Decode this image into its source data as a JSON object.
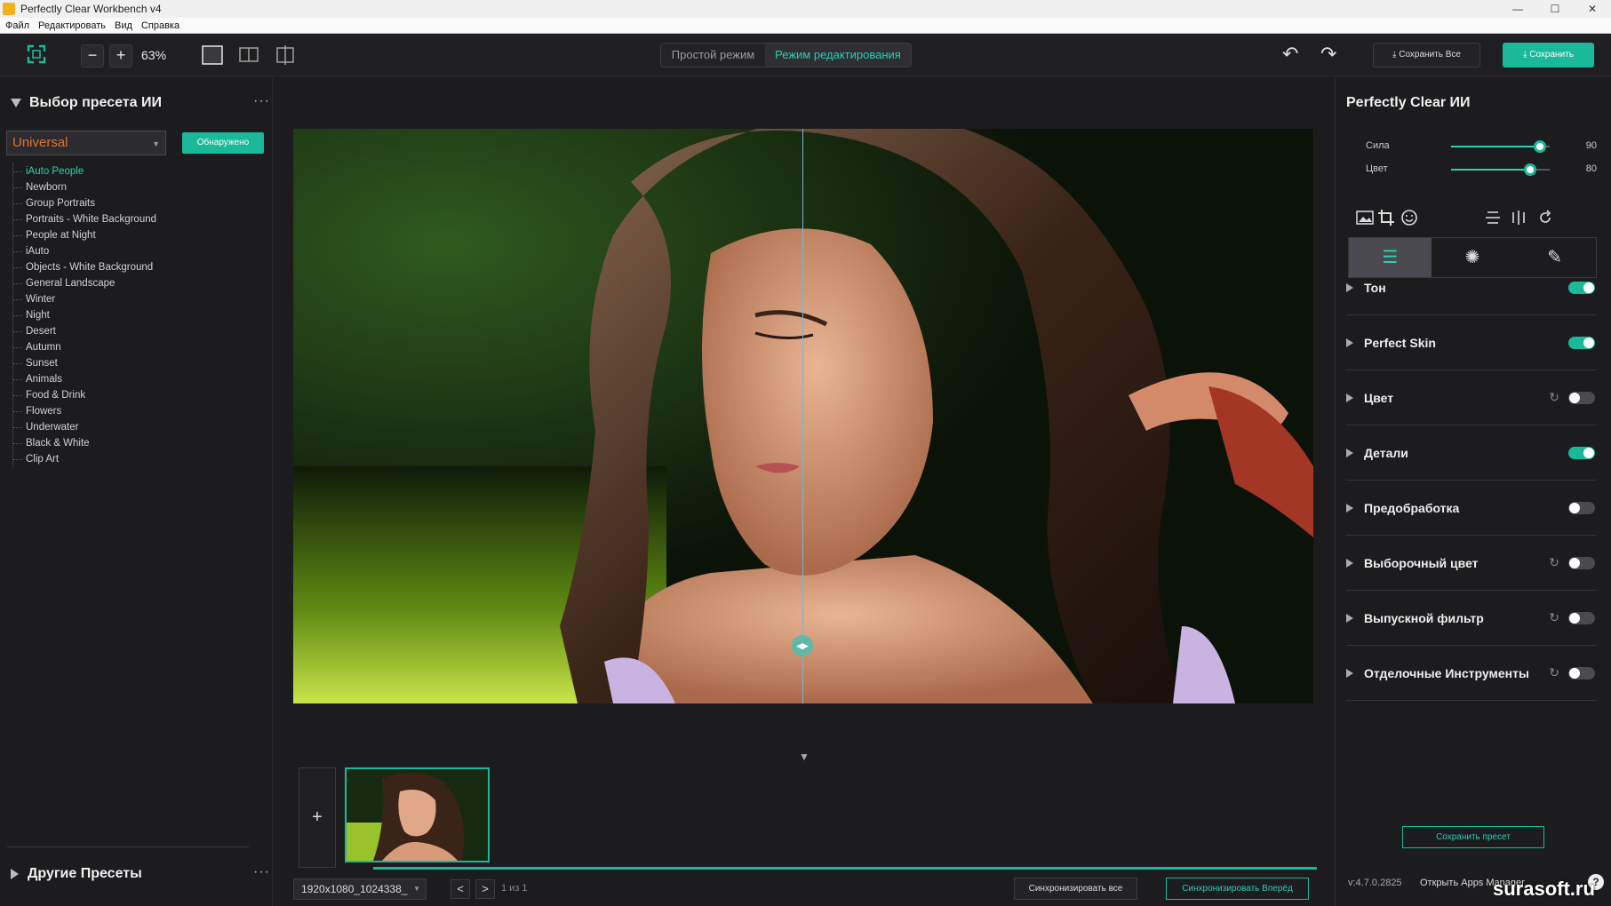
{
  "window": {
    "title": "Perfectly Clear Workbench v4",
    "min": "—",
    "max": "☐",
    "close": "✕"
  },
  "menu": [
    "Файл",
    "Редактировать",
    "Вид",
    "Справка"
  ],
  "toolbar": {
    "zoom_out": "−",
    "zoom_in": "+",
    "zoom": "63%",
    "mode_simple": "Простой режим",
    "mode_edit": "Режим редактирования",
    "undo_icon": "↶",
    "redo_icon": "↷",
    "save_all": "Сохранить Все",
    "save": "Сохранить"
  },
  "left": {
    "title": "Выбор пресета ИИ",
    "preset": "Universal",
    "detected": "Обнаружено",
    "presets": [
      "iAuto People",
      "Newborn",
      "Group Portraits",
      "Portraits - White Background",
      "People at Night",
      "iAuto",
      "Objects - White Background",
      "General Landscape",
      "Winter",
      "Night",
      "Desert",
      "Autumn",
      "Sunset",
      "Animals",
      "Food & Drink",
      "Flowers",
      "Underwater",
      "Black & White",
      "Clip Art"
    ],
    "other_presets": "Другие Пресеты"
  },
  "bottom": {
    "add": "+",
    "file": "1920x1080_1024338_",
    "prev": "<",
    "next": ">",
    "count": "1 из 1",
    "sync_all": "Синхронизировать все",
    "sync_forward": "Синхронизировать Вперёд"
  },
  "right": {
    "title": "Perfectly Clear ИИ",
    "sliders": [
      {
        "label": "Сила",
        "value": "90",
        "level": 0.9
      },
      {
        "label": "Цвет",
        "value": "80",
        "level": 0.8
      }
    ],
    "sections": [
      {
        "name": "Тон",
        "on": true,
        "reset": false
      },
      {
        "name": "Perfect Skin",
        "on": true,
        "reset": false
      },
      {
        "name": "Цвет",
        "on": false,
        "reset": true
      },
      {
        "name": "Детали",
        "on": true,
        "reset": false
      },
      {
        "name": "Предобработка",
        "on": false,
        "reset": false
      },
      {
        "name": "Выборочный цвет",
        "on": false,
        "reset": true
      },
      {
        "name": "Выпускной фильтр",
        "on": false,
        "reset": true
      },
      {
        "name": "Отделочные Инструменты",
        "on": false,
        "reset": true
      }
    ],
    "save_preset": "Сохранить пресет",
    "version": "v:4.7.0.2825",
    "apps_manager": "Открыть Apps Manager",
    "help": "?"
  },
  "watermark": "surasoft.ru"
}
